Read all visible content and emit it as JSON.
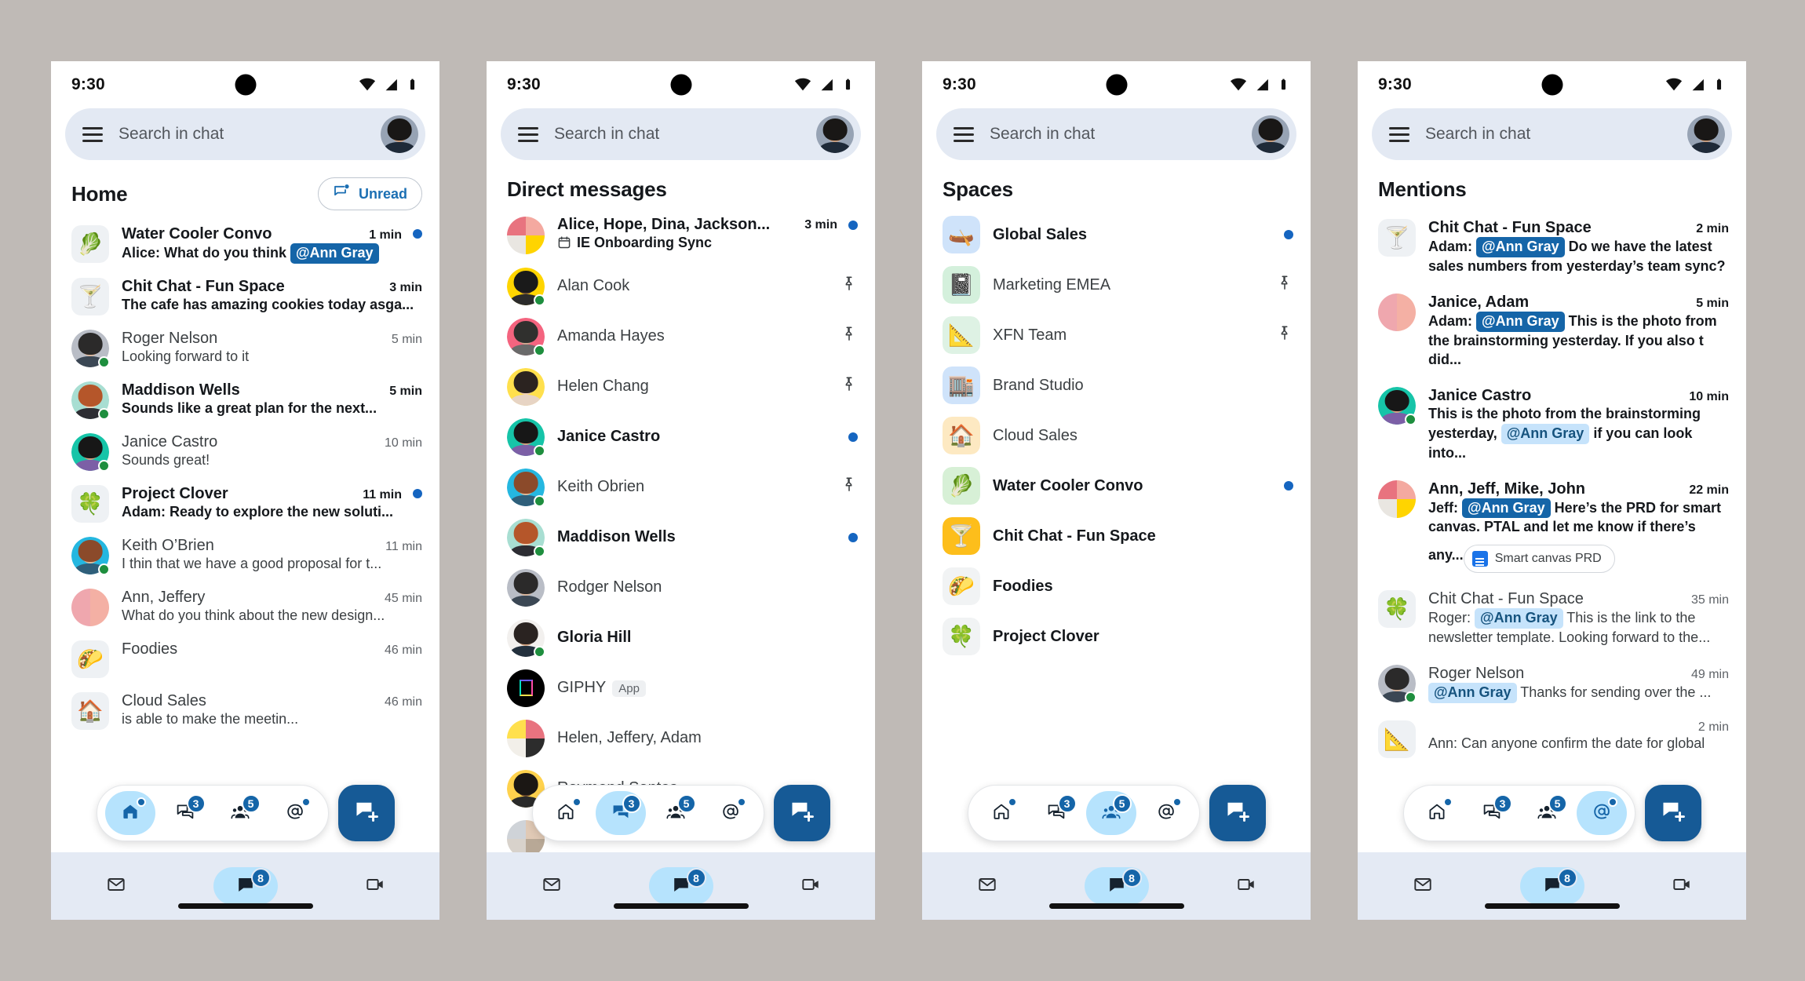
{
  "status": {
    "time": "9:30"
  },
  "search": {
    "placeholder": "Search in chat"
  },
  "phones": [
    {
      "id": "home",
      "title": "Home",
      "unread_button": "Unread",
      "rows": [
        {
          "kind": "chat",
          "title": "Water Cooler Convo",
          "snippet_prefix": "Alice: What do you think ",
          "chip": "@Ann Gray",
          "chip_style": "dark",
          "time": "1 min",
          "unread": true,
          "avatar": "space-water",
          "emoji": "🥬"
        },
        {
          "kind": "chat",
          "title": "Chit Chat - Fun Space",
          "snippet": "The cafe has amazing cookies today asga...",
          "time": "3 min",
          "unread": true,
          "avatar": "space-chit",
          "emoji": "🍸"
        },
        {
          "kind": "chat",
          "title": "Roger Nelson",
          "snippet": "Looking forward to it",
          "time": "5 min",
          "unread": false,
          "avatar": "person-roger",
          "presence": true
        },
        {
          "kind": "chat",
          "title": "Maddison Wells",
          "snippet": "Sounds like a great plan for the next...",
          "time": "5 min",
          "unread": true,
          "avatar": "person-maddison",
          "presence": true
        },
        {
          "kind": "chat",
          "title": "Janice Castro",
          "snippet": "Sounds great!",
          "time": "10 min",
          "unread": false,
          "avatar": "person-janice",
          "presence": true
        },
        {
          "kind": "chat",
          "title": "Project Clover",
          "snippet": "Adam: Ready to explore the new soluti...",
          "time": "11 min",
          "unread": true,
          "avatar": "space-clover",
          "emoji": "🍀"
        },
        {
          "kind": "chat",
          "title": "Keith O’Brien",
          "snippet": "I thin that we have a good proposal for t...",
          "time": "11 min",
          "unread": false,
          "avatar": "person-keith",
          "presence": true
        },
        {
          "kind": "chat",
          "title": "Ann, Jeffery",
          "snippet": "What do you think about the new design...",
          "time": "45 min",
          "unread": false,
          "avatar": "group-ann-jeffery"
        },
        {
          "kind": "chat",
          "title": "Foodies",
          "snippet": "",
          "time": "46 min",
          "unread": false,
          "avatar": "space-foodies",
          "emoji": "🌮"
        },
        {
          "kind": "chat",
          "title": "Cloud Sales",
          "snippet": "is able to make the meetin...",
          "time": "46 min",
          "unread": false,
          "avatar": "space-cloud",
          "emoji": "🏠"
        }
      ],
      "active_nav": "home"
    },
    {
      "id": "dm",
      "title": "Direct messages",
      "rows": [
        {
          "kind": "dm",
          "title": "Alice, Hope, Dina, Jackson...",
          "snippet": "IE Onboarding Sync",
          "snippet_icon": "calendar-icon",
          "time": "3 min",
          "unread": true,
          "dot": true,
          "avatar": "group-quad-a"
        },
        {
          "kind": "dm",
          "title": "Alan Cook",
          "time": "",
          "unread": false,
          "pinned": true,
          "avatar": "person-alan",
          "presence": true
        },
        {
          "kind": "dm",
          "title": "Amanda Hayes",
          "time": "",
          "unread": false,
          "pinned": true,
          "avatar": "person-amanda",
          "presence": true
        },
        {
          "kind": "dm",
          "title": "Helen Chang",
          "time": "",
          "unread": false,
          "pinned": true,
          "avatar": "person-helen",
          "presence": false
        },
        {
          "kind": "dm",
          "title": "Janice Castro",
          "time": "",
          "unread": true,
          "dot": true,
          "avatar": "person-janice",
          "presence": true
        },
        {
          "kind": "dm",
          "title": "Keith Obrien",
          "time": "",
          "unread": false,
          "pinned": true,
          "avatar": "person-keith",
          "presence": true
        },
        {
          "kind": "dm",
          "title": "Maddison Wells",
          "time": "",
          "unread": true,
          "dot": true,
          "avatar": "person-maddison",
          "presence": true
        },
        {
          "kind": "dm",
          "title": "Rodger Nelson",
          "time": "",
          "unread": false,
          "avatar": "person-roger",
          "presence": false
        },
        {
          "kind": "dm",
          "title": "Gloria Hill",
          "time": "",
          "unread": true,
          "avatar": "person-gloria",
          "presence": true
        },
        {
          "kind": "dm",
          "title": "GIPHY",
          "badge": "App",
          "time": "",
          "unread": false,
          "avatar": "app-giphy"
        },
        {
          "kind": "dm",
          "title": "Helen, Jeffery, Adam",
          "time": "",
          "unread": false,
          "avatar": "group-quad-b"
        },
        {
          "kind": "dm",
          "title": "Raymond Santos",
          "time": "",
          "unread": false,
          "avatar": "person-raymond"
        },
        {
          "kind": "dm",
          "title": "",
          "time": "",
          "unread": false,
          "avatar": "group-quad-c"
        }
      ],
      "active_nav": "dm"
    },
    {
      "id": "spaces",
      "title": "Spaces",
      "rows": [
        {
          "kind": "space",
          "title": "Global Sales",
          "unread": true,
          "dot": true,
          "emoji": "🛶",
          "tint": "#cfe3fa"
        },
        {
          "kind": "space",
          "title": "Marketing EMEA",
          "unread": false,
          "pinned": true,
          "emoji": "📓",
          "tint": "#d4f0dc"
        },
        {
          "kind": "space",
          "title": "XFN Team",
          "unread": false,
          "pinned": true,
          "emoji": "📐",
          "tint": "#def2e4"
        },
        {
          "kind": "space",
          "title": "Brand Studio",
          "unread": false,
          "emoji": "🏬",
          "tint": "#cfe3fa"
        },
        {
          "kind": "space",
          "title": "Cloud Sales",
          "unread": false,
          "emoji": "🏠",
          "tint": "#fde9c2"
        },
        {
          "kind": "space",
          "title": "Water Cooler Convo",
          "unread": true,
          "dot": true,
          "emoji": "🥬",
          "tint": "#d7f0d6"
        },
        {
          "kind": "space",
          "title": "Chit Chat - Fun Space",
          "unread": true,
          "emoji": "🍸",
          "tint": "#fdbe1b"
        },
        {
          "kind": "space",
          "title": "Foodies",
          "unread": true,
          "emoji": "🌮",
          "tint": "#f1f3f4"
        },
        {
          "kind": "space",
          "title": "Project Clover",
          "unread": true,
          "emoji": "🍀",
          "tint": "#f1f3f4"
        }
      ],
      "active_nav": "spaces"
    },
    {
      "id": "mentions",
      "title": "Mentions",
      "rows": [
        {
          "kind": "mention",
          "title": "Chit Chat - Fun Space",
          "time": "2 min",
          "unread": true,
          "avatar": "space-chit",
          "emoji": "🍸",
          "prefix": "Adam: ",
          "chip": "@Ann Gray",
          "chip_style": "dark",
          "suffix": " Do we have the latest sales numbers from yesterday’s team sync?"
        },
        {
          "kind": "mention",
          "title": "Janice, Adam",
          "time": "5 min",
          "unread": true,
          "avatar": "group-ann-jeffery",
          "prefix": "Adam: ",
          "chip": "@Ann Gray",
          "chip_style": "dark",
          "suffix": " This is the photo from the brainstorming yesterday. If you also t  did...",
          "photo": true
        },
        {
          "kind": "mention",
          "title": "Janice Castro",
          "time": "10 min",
          "unread": true,
          "avatar": "person-janice",
          "presence": true,
          "prefix": "This is the photo from the brainstorming yesterday, ",
          "chip": "@Ann Gray",
          "chip_style": "light",
          "suffix": " if you can look into..."
        },
        {
          "kind": "mention",
          "title": "Ann, Jeff, Mike, John",
          "time": "22 min",
          "unread": true,
          "avatar": "group-quad-a",
          "prefix": "Jeff: ",
          "chip": "@Ann Gray",
          "chip_style": "dark",
          "suffix": " Here’s the PRD for smart canvas. PTAL and let me know if there’s any...",
          "doc_chip": "Smart canvas PRD"
        },
        {
          "kind": "mention",
          "title": "Chit Chat - Fun Space",
          "time": "35 min",
          "unread": false,
          "avatar": "space-clover",
          "emoji": "🍀",
          "prefix": "Roger: ",
          "chip": "@Ann Gray",
          "chip_style": "light",
          "suffix": " This is the link to the newsletter template. Looking forward to the..."
        },
        {
          "kind": "mention",
          "title": "Roger Nelson",
          "time": "49 min",
          "unread": false,
          "avatar": "person-roger",
          "presence": true,
          "prefix": "",
          "chip": "@Ann Gray",
          "chip_style": "light",
          "suffix": " Thanks for sending over the ..."
        },
        {
          "kind": "mention",
          "title": "",
          "time": "2 min",
          "unread": false,
          "avatar": "space-xfn",
          "emoji": "📐",
          "prefix": "Ann: Can anyone confirm the date for global",
          "chip": "",
          "chip_style": "none",
          "suffix": ""
        }
      ],
      "active_nav": "mentions"
    }
  ],
  "floating_nav": {
    "items": [
      {
        "key": "home",
        "icon": "home-icon",
        "dot": true
      },
      {
        "key": "dm",
        "icon": "chat-bubbles-icon",
        "count": "3"
      },
      {
        "key": "spaces",
        "icon": "people-group-icon",
        "count": "5"
      },
      {
        "key": "mentions",
        "icon": "at-mention-icon",
        "dot": true
      }
    ],
    "fab": {
      "icon": "new-chat-icon",
      "label": ""
    }
  },
  "bottom_bar": {
    "items": [
      {
        "key": "mail",
        "icon": "mail-icon",
        "active": false
      },
      {
        "key": "chat",
        "icon": "chat-flag-icon",
        "active": true,
        "count": "8"
      },
      {
        "key": "meet",
        "icon": "video-camera-icon",
        "active": false
      }
    ]
  },
  "colors": {
    "accent": "#1565a8",
    "fab": "#165a96",
    "active_pill": "#b6e3fd",
    "search_bg": "#e3e9f3",
    "bottom_bar_bg": "#e4eaf4",
    "page_bg": "#bfbab6",
    "unread_dot": "#1565c0",
    "presence_green": "#1e8e3e"
  }
}
